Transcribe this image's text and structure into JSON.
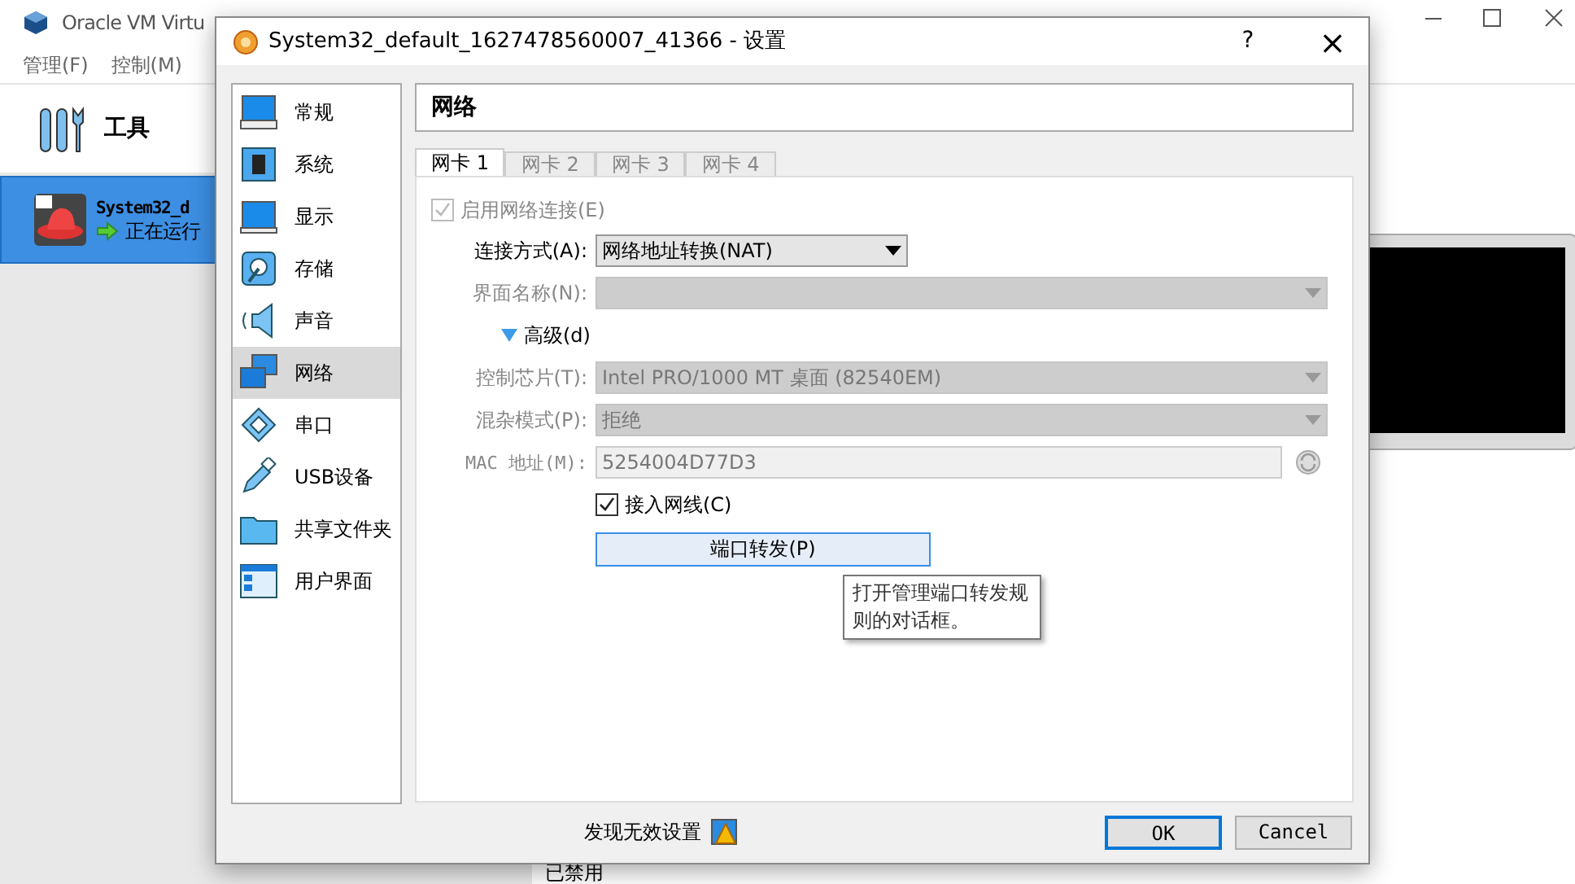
{
  "main_window": {
    "title": "Oracle VM Virtu",
    "menu": [
      "管理(F)",
      "控制(M)"
    ],
    "tools_label": "工具",
    "vm": {
      "name": "System32_d",
      "state": "正在运行",
      "selected": true
    },
    "detail_text": "已禁用"
  },
  "dialog": {
    "title": "System32_default_1627478560007_41366 - 设置",
    "help": "?",
    "close": "×",
    "categories": [
      {
        "label": "常规",
        "kind": "general",
        "selected": false
      },
      {
        "label": "系统",
        "kind": "system",
        "selected": false
      },
      {
        "label": "显示",
        "kind": "display",
        "selected": false
      },
      {
        "label": "存储",
        "kind": "storage",
        "selected": false
      },
      {
        "label": "声音",
        "kind": "audio",
        "selected": false
      },
      {
        "label": "网络",
        "kind": "network",
        "selected": true
      },
      {
        "label": "串口",
        "kind": "serial",
        "selected": false
      },
      {
        "label": "USB设备",
        "kind": "usb",
        "selected": false
      },
      {
        "label": "共享文件夹",
        "kind": "folder",
        "selected": false
      },
      {
        "label": "用户界面",
        "kind": "ui",
        "selected": false
      }
    ],
    "section_title": "网络",
    "tabs": [
      {
        "label": "网卡 1",
        "selected": true
      },
      {
        "label": "网卡 2",
        "selected": false
      },
      {
        "label": "网卡 3",
        "selected": false
      },
      {
        "label": "网卡 4",
        "selected": false
      }
    ],
    "enable_adapter": {
      "label": "启用网络连接(E)",
      "checked": true,
      "disabled": true
    },
    "fields": [
      {
        "kind": "select",
        "label": "连接方式(A):",
        "value": "网络地址转换(NAT)",
        "disabled": false
      },
      {
        "kind": "select",
        "label": "界面名称(N):",
        "disabled": true
      },
      {
        "kind": "expander",
        "label": "高级(d)",
        "expanded": true
      },
      {
        "kind": "select",
        "label": "控制芯片(T):",
        "value": "Intel PRO/1000 MT 桌面 (82540EM)",
        "disabled": true
      },
      {
        "kind": "select",
        "label": "混杂模式(P):",
        "value": "拒绝",
        "disabled": true
      },
      {
        "kind": "text",
        "label": "MAC 地址(M):",
        "value": "5254004D77D3",
        "disabled": true
      },
      {
        "kind": "checkbox",
        "label": "接入网线(C)",
        "checked": true
      },
      {
        "kind": "button",
        "label": "端口转发(P)"
      }
    ],
    "tooltip": "打开管理端口转发规则的对话框。",
    "warning": "发现无效设置",
    "buttons": [
      {
        "label": "OK",
        "default": true
      },
      {
        "label": "Cancel",
        "default": false
      }
    ]
  }
}
